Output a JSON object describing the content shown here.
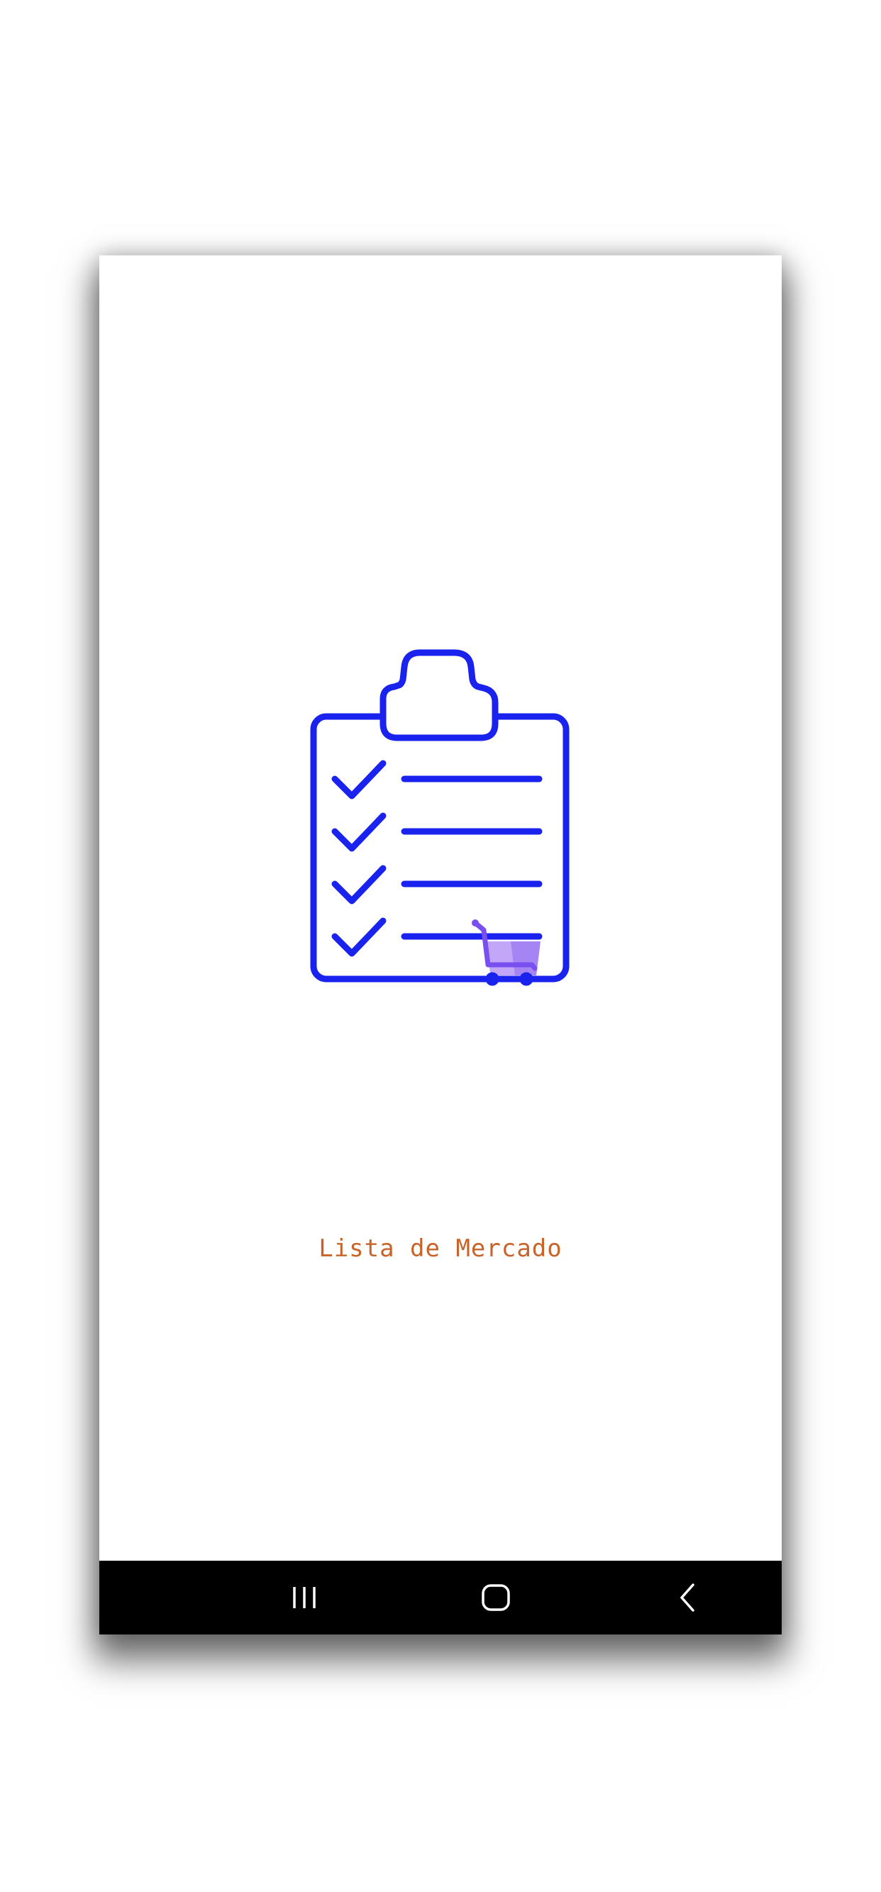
{
  "app": {
    "title": "Lista de Mercado"
  },
  "logo": {
    "icon": "clipboard-checklist-cart-icon",
    "stroke_color": "#1a22ee",
    "cart_color": "#7a4ff0",
    "cart_fill_color": "#c2a6f7"
  },
  "colors": {
    "title": "#c8642a",
    "navbar": "#000000",
    "nav_icon": "#ffffff"
  },
  "navigation": {
    "recents_icon": "recent-apps-icon",
    "home_icon": "home-icon",
    "back_icon": "back-icon"
  }
}
